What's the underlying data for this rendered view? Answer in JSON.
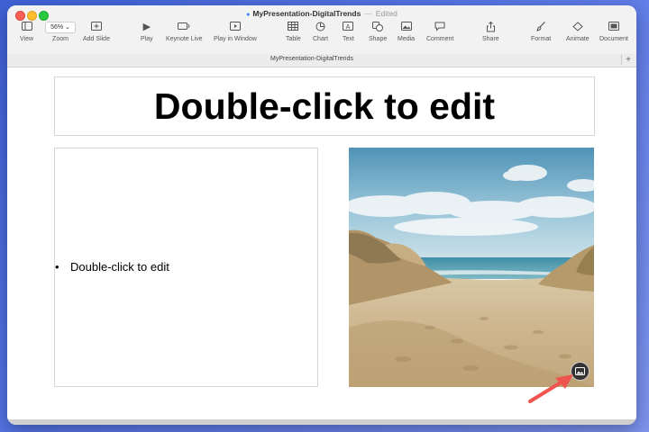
{
  "window": {
    "title": "MyPresentation-DigitalTrends",
    "separator": "—",
    "status": "Edited"
  },
  "toolbar": {
    "view": "View",
    "zoom_value": "56%",
    "zoom": "Zoom",
    "add_slide": "Add Slide",
    "play": "Play",
    "keynote_live": "Keynote Live",
    "play_in_window": "Play in Window",
    "table": "Table",
    "chart": "Chart",
    "text": "Text",
    "shape": "Shape",
    "media": "Media",
    "comment": "Comment",
    "share": "Share",
    "format": "Format",
    "animate": "Animate",
    "document": "Document"
  },
  "tab": {
    "label": "MyPresentation-DigitalTrends",
    "add": "+"
  },
  "slide": {
    "title_placeholder": "Double-click to edit",
    "bullet_mark": "•",
    "body_placeholder": "Double-click to edit"
  },
  "colors": {
    "annotation_arrow": "#f0544f",
    "desktop": "#4a6ddf"
  }
}
